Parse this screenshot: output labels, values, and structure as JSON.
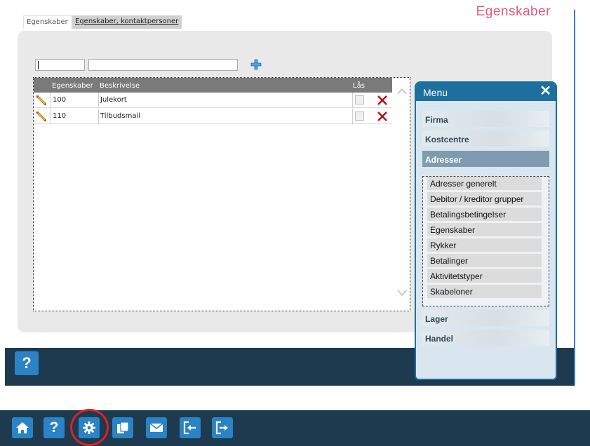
{
  "page": {
    "title": "Egenskaber"
  },
  "tabs": [
    {
      "label": "Egenskaber"
    },
    {
      "label": "Egenskaber, kontaktpersoner"
    }
  ],
  "grid": {
    "columns": {
      "egenskaber": "Egenskaber",
      "beskrivelse": "Beskrivelse",
      "laas": "Lås"
    },
    "rows": [
      {
        "egenskaber": "100",
        "beskrivelse": "Julekort"
      },
      {
        "egenskaber": "110",
        "beskrivelse": "Tilbudsmail"
      }
    ]
  },
  "menu": {
    "title": "Menu",
    "close": "✕",
    "sections": [
      {
        "label": "Firma"
      },
      {
        "label": "Kostcentre"
      },
      {
        "label": "Adresser"
      },
      {
        "label": "Lager"
      },
      {
        "label": "Handel"
      }
    ],
    "adresser_items": [
      {
        "label": "Adresser generelt"
      },
      {
        "label": "Debitor / kreditor grupper"
      },
      {
        "label": "Betalingsbetingelser"
      },
      {
        "label": "Egenskaber"
      },
      {
        "label": "Rykker"
      },
      {
        "label": "Betalinger"
      },
      {
        "label": "Aktivitetstyper"
      },
      {
        "label": "Skabeloner"
      }
    ]
  },
  "footer": {
    "help_label": "?"
  },
  "taskbar": {
    "help_label": "?",
    "icons": [
      "home-icon",
      "help-icon",
      "gear-icon",
      "documents-icon",
      "mail-icon",
      "login-icon",
      "logout-icon"
    ]
  },
  "colors": {
    "accent_blue": "#2a83c4",
    "dark_bar": "#1e3a4e",
    "title_pink": "#e05a7a",
    "delete_red": "#c01010",
    "highlight_red": "#e02020"
  }
}
